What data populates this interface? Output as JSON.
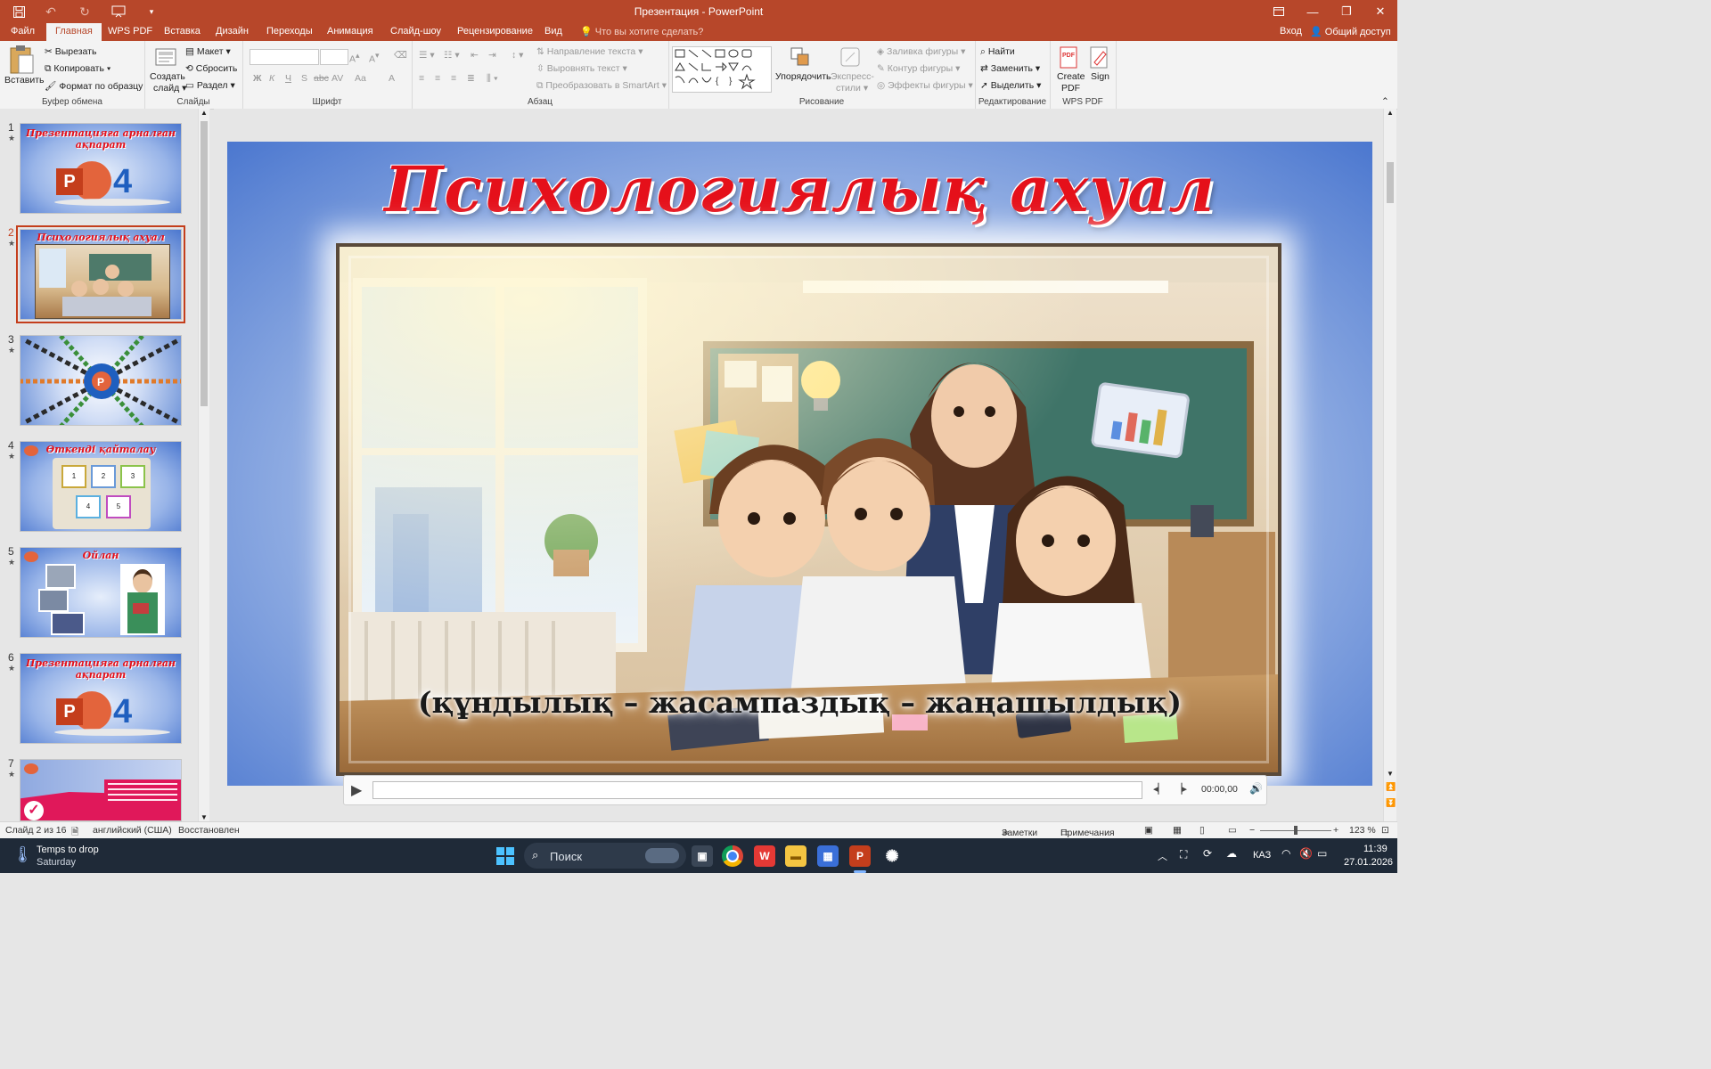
{
  "window": {
    "title": "Презентация - PowerPoint",
    "qat": [
      "save-icon",
      "undo-icon",
      "redo-icon",
      "slideshow-from-start-icon",
      "customize-qat-icon"
    ]
  },
  "tabs": [
    "Файл",
    "Главная",
    "WPS PDF",
    "Вставка",
    "Дизайн",
    "Переходы",
    "Анимация",
    "Слайд-шоу",
    "Рецензирование",
    "Вид"
  ],
  "active_tab": "Главная",
  "tell_me": "Что вы хотите сделать?",
  "signin": "Вход",
  "share": "Общий доступ",
  "ribbon": {
    "clipboard": {
      "paste": "Вставить",
      "cut": "Вырезать",
      "copy": "Копировать",
      "format_painter": "Формат по образцу",
      "label": "Буфер обмена"
    },
    "slides": {
      "new_slide_1": "Создать",
      "new_slide_2": "слайд",
      "layout": "Макет",
      "reset": "Сбросить",
      "section": "Раздел",
      "label": "Слайды"
    },
    "font": {
      "label": "Шрифт",
      "bold": "Ж",
      "italic": "К",
      "underline": "Ч",
      "shadow": "S",
      "spacing": "AV",
      "case": "Aa",
      "color": "A"
    },
    "paragraph": {
      "text_direction": "Направление текста",
      "align_text": "Выровнять текст",
      "smartart": "Преобразовать в SmartArt",
      "label": "Абзац"
    },
    "drawing": {
      "arrange": "Упорядочить",
      "quick_styles_1": "Экспресс-",
      "quick_styles_2": "стили",
      "fill": "Заливка фигуры",
      "outline": "Контур фигуры",
      "effects": "Эффекты фигуры",
      "label": "Рисование"
    },
    "editing": {
      "find": "Найти",
      "replace": "Заменить",
      "select": "Выделить",
      "label": "Редактирование"
    },
    "wps": {
      "create_pdf_1": "Create",
      "create_pdf_2": "PDF",
      "sign": "Sign",
      "label": "WPS PDF"
    }
  },
  "thumbnails": [
    {
      "num": "1",
      "title": "Презентацияға арналған ақпарат",
      "kind": "ppt4",
      "selected": false
    },
    {
      "num": "2",
      "title": "Психологиялық ахуал",
      "kind": "photo",
      "selected": true
    },
    {
      "num": "3",
      "title": "",
      "kind": "radial",
      "selected": false
    },
    {
      "num": "4",
      "title": "Өткенді қайталау",
      "kind": "boxes",
      "selected": false
    },
    {
      "num": "5",
      "title": "Ойлан",
      "kind": "photos",
      "selected": false
    },
    {
      "num": "6",
      "title": "Презентацияға арналған ақпарат",
      "kind": "ppt4",
      "selected": false
    },
    {
      "num": "7",
      "title": "",
      "kind": "pink",
      "selected": false
    }
  ],
  "slide": {
    "title": "Психологиялық ахуал",
    "subtitle": "(құндылық – жасампаздық – жаңашылдық)"
  },
  "media": {
    "time": "00:00,00"
  },
  "status": {
    "slide_count": "Слайд 2 из 16",
    "language": "английский (США)",
    "recovered": "Восстановлен",
    "notes": "Заметки",
    "comments": "Примечания",
    "zoom": "123 %"
  },
  "taskbar": {
    "weather_line1": "Temps to drop",
    "weather_line2": "Saturday",
    "search_placeholder": "Поиск",
    "lang": "КАЗ",
    "time": "11:39",
    "date": "27.01.2026"
  },
  "colors": {
    "accent": "#b7472a",
    "title_red": "#e5101a",
    "slide_blue": "#4b77cf"
  }
}
